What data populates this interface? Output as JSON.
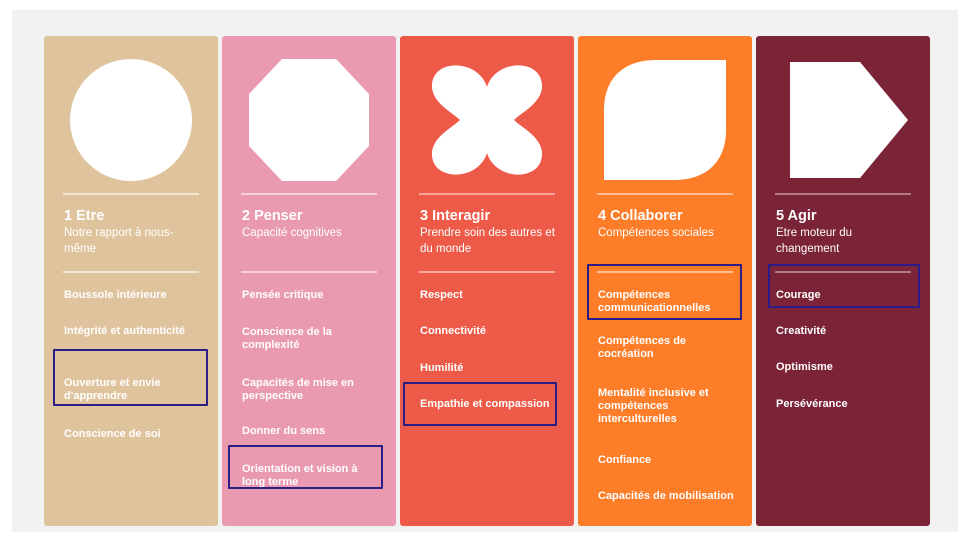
{
  "colors": {
    "c1": "#dfc39d",
    "c2": "#e99ab0",
    "c3": "#ee5a48",
    "c4": "#fe7d28",
    "c5": "#7b2337",
    "highlight": "#2b1d85"
  },
  "columns": [
    {
      "title": "1 Etre",
      "subtitle": "Notre rapport à nous-même",
      "shape_icon": "circle",
      "items": [
        "Boussole intérieure",
        "Intégrité et authenticité",
        "Ouverture et envie d'apprendre",
        "Conscience de soi"
      ]
    },
    {
      "title": "2 Penser",
      "subtitle": "Capacité cognitives",
      "shape_icon": "octagon",
      "items": [
        "Pensée critique",
        "Conscience de la complexité",
        "Capacités de mise en perspective",
        "Donner du sens",
        "Orientation et vision à long terme"
      ]
    },
    {
      "title": "3 Interagir",
      "subtitle": "Prendre soin des autres et du monde",
      "shape_icon": "four-lobed-cross",
      "items": [
        "Respect",
        "Connectivité",
        "Humilité",
        "Empathie et compassion"
      ]
    },
    {
      "title": "4 Collaborer",
      "subtitle": "Compétences sociales",
      "shape_icon": "leaf",
      "items": [
        "Compétences communicationnelles",
        "Compétences de cocréation",
        "Mentalité inclusive et compétences interculturelles",
        "Confiance",
        "Capacités de mobilisation"
      ]
    },
    {
      "title": "5 Agir",
      "subtitle": "Etre moteur du changement",
      "shape_icon": "pentagon-arrow",
      "items": [
        "Courage",
        "Creativité",
        "Optimisme",
        "Persévérance"
      ]
    }
  ]
}
